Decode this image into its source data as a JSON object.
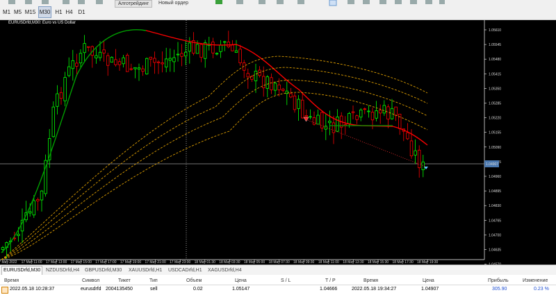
{
  "toolbar": {
    "timeframes": [
      "M1",
      "M5",
      "M15",
      "M30",
      "H1",
      "H4",
      "D1"
    ],
    "active_timeframe": "M30",
    "algo_label": "Алготрейдинг",
    "new_order_label": "Новый ордер"
  },
  "chart": {
    "title": "EURUSDrfd,M30:  Euro vs US Dollar",
    "current_price": "1.04907",
    "price_ticks": [
      "1.05610",
      "1.05545",
      "1.05480",
      "1.05415",
      "1.05350",
      "1.05285",
      "1.05220",
      "1.05155",
      "1.05090",
      "1.05025",
      "1.04960",
      "1.04895",
      "1.04830",
      "1.04765",
      "1.04700",
      "1.04635",
      "1.04570",
      "1.04505"
    ],
    "time_ticks": [
      "17 May 2022",
      "17 May 11:00",
      "17 May 13:00",
      "17 May 15:00",
      "17 May 17:00",
      "17 May 19:00",
      "17 May 21:00",
      "17 May 23:00",
      "18 May 01:30",
      "18 May 03:30",
      "18 May 05:00",
      "18 May 07:30",
      "18 May 09:30",
      "18 May 11:00",
      "18 May 13:30",
      "18 May 15:30",
      "18 May 17:30",
      "18 May 19:30"
    ],
    "colors": {
      "bull_candle": "#00ff00",
      "bear_candle": "#ff0000",
      "ma_up": "#00a000",
      "ma_down": "#ff0000",
      "bands": "#e0a000",
      "trade_line": "#ff3030"
    }
  },
  "tabs": [
    "EURUSDrfd,M30",
    "NZDUSDrfd,H4",
    "GBPUSDrfd,M30",
    "XAUUSDrfd,H1",
    "USDCADrfd,H1",
    "XAGUSDrfd,H4"
  ],
  "active_tab": "EURUSDrfd,M30",
  "positions": {
    "headers": {
      "time": "Время",
      "symbol": "Символ",
      "ticket": "Тикет",
      "type": "Тип",
      "volume": "Объем",
      "price": "Цена",
      "sl": "S / L",
      "tp": "T / P",
      "time2": "Время",
      "cur_price": "Цена",
      "profit": "Прибыль",
      "change": "Изменение"
    },
    "row": {
      "time": "2022.05.18 10:28:37",
      "symbol": "eurusdrfd",
      "ticket": "2004135450",
      "type": "sell",
      "volume": "0.02",
      "price": "1.05147",
      "sl": "",
      "tp": "1.04666",
      "time2": "2022.05.18 19:34:27",
      "cur_price": "1.04907",
      "profit": "305.90",
      "change": "0.23 %"
    }
  }
}
